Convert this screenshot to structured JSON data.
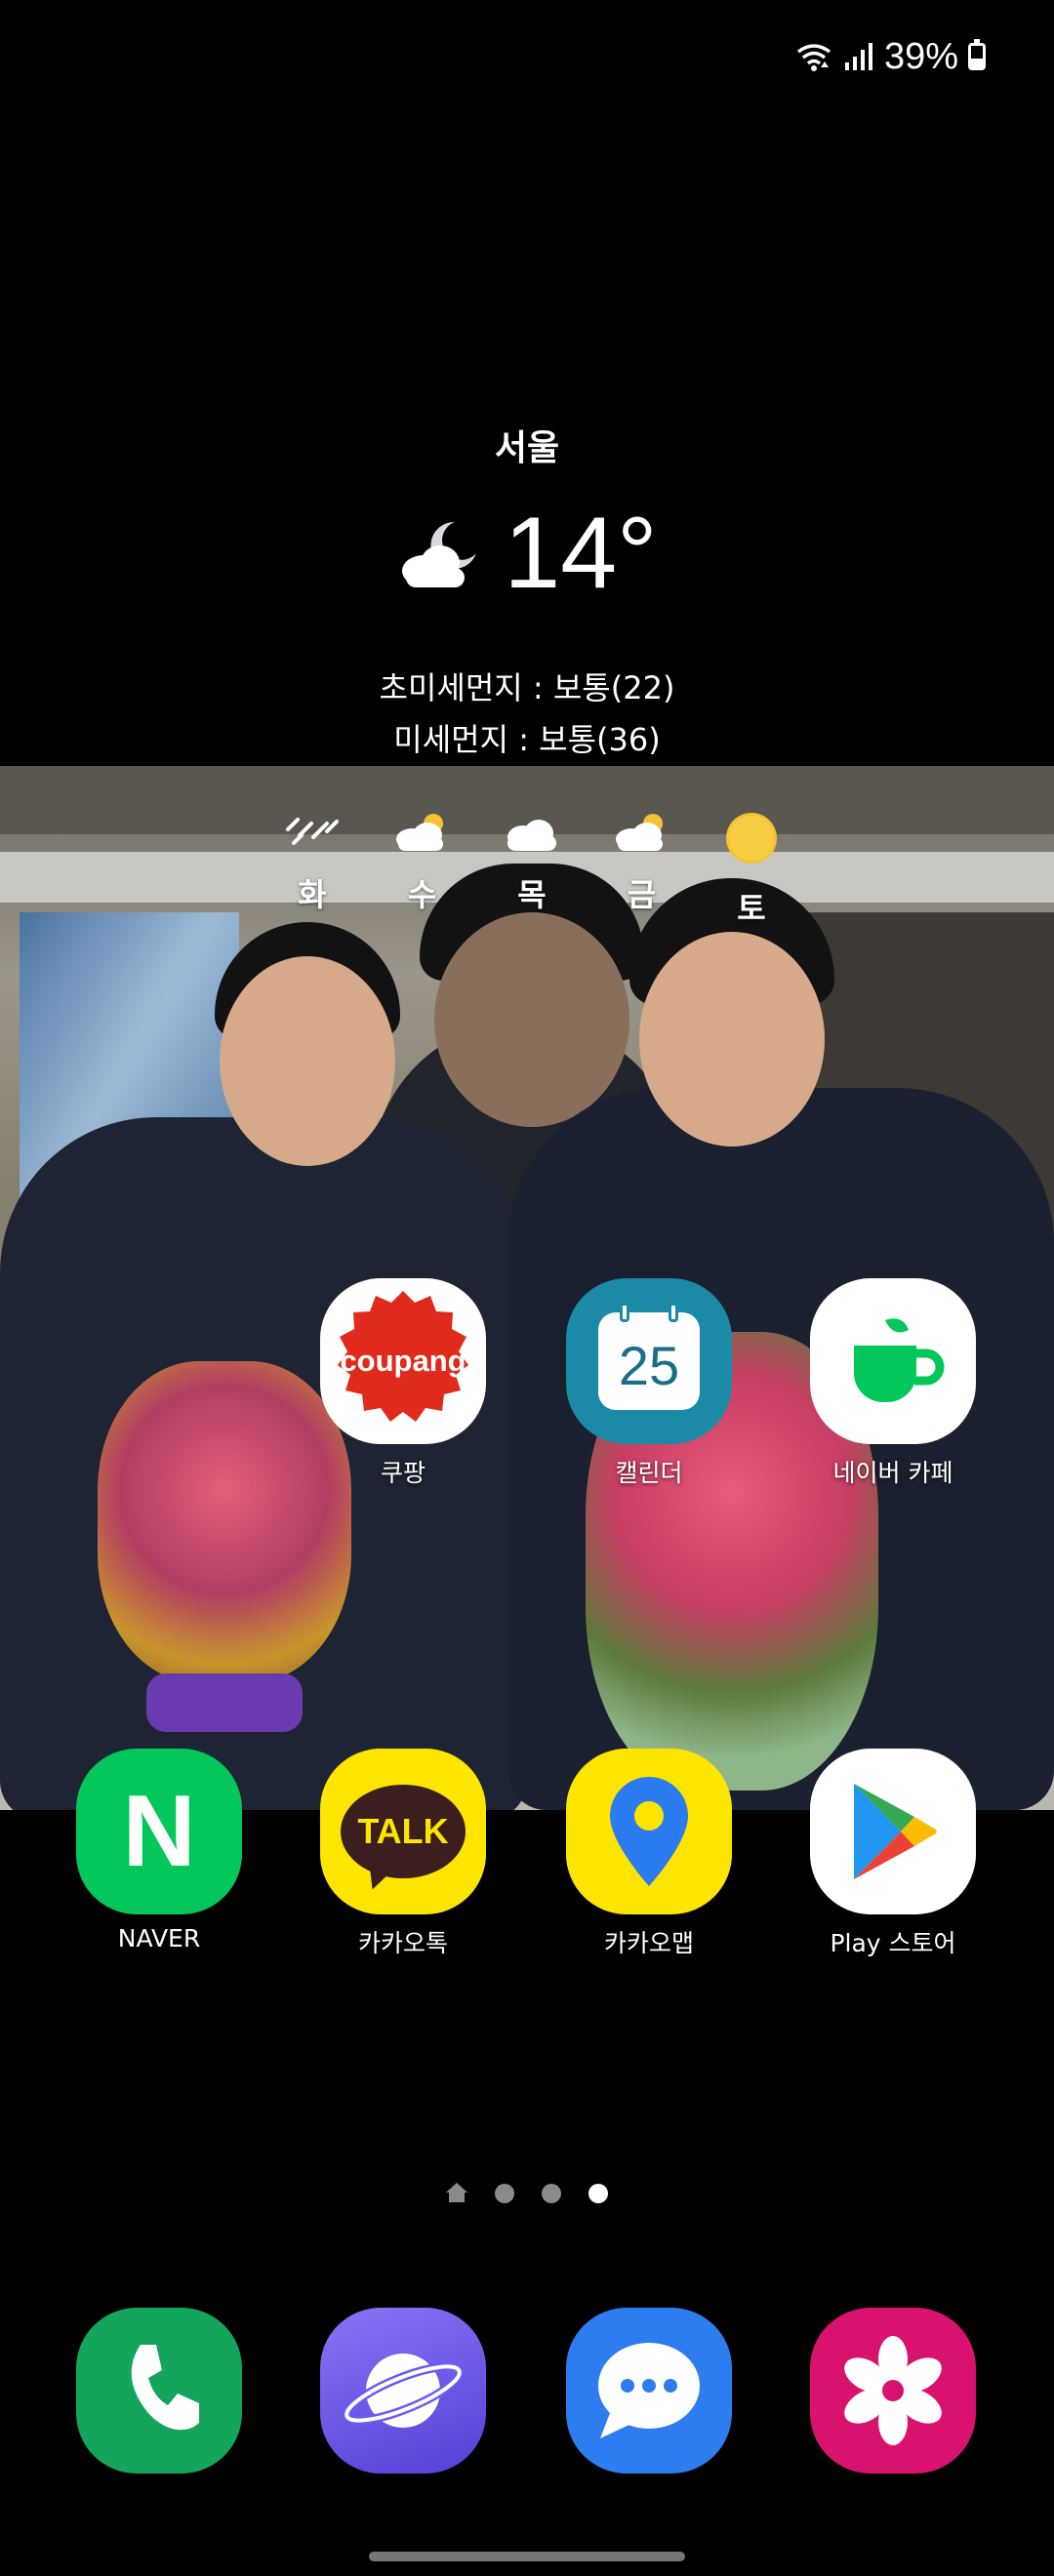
{
  "status_bar": {
    "battery_percent": "39%",
    "battery_level": 0.39
  },
  "weather": {
    "city": "서울",
    "temperature": "14°",
    "condition_icon": "moon-cloud-icon",
    "fine_dust_ultra": "초미세먼지 : 보통(22)",
    "fine_dust": "미세먼지 : 보통(36)",
    "forecast": [
      {
        "day": "화",
        "icon": "rain-icon"
      },
      {
        "day": "수",
        "icon": "sun-cloud-icon"
      },
      {
        "day": "목",
        "icon": "cloud-icon"
      },
      {
        "day": "금",
        "icon": "sun-cloud-icon"
      },
      {
        "day": "토",
        "icon": "sun-icon"
      }
    ]
  },
  "apps_row1": [
    {
      "label": "쿠팡",
      "icon_text": "coupang"
    },
    {
      "label": "캘린더",
      "icon_text": "25"
    },
    {
      "label": "네이버 카페",
      "icon_text": ""
    }
  ],
  "apps_row2": [
    {
      "label": "NAVER",
      "icon_text": "N"
    },
    {
      "label": "카카오톡",
      "icon_text": "TALK"
    },
    {
      "label": "카카오맵",
      "icon_text": ""
    },
    {
      "label": "Play 스토어",
      "icon_text": ""
    }
  ],
  "page_indicator": {
    "pages": 4,
    "current": 4
  },
  "dock": [
    {
      "name": "phone",
      "icon": "phone-icon"
    },
    {
      "name": "internet",
      "icon": "planet-icon"
    },
    {
      "name": "messages",
      "icon": "chat-icon"
    },
    {
      "name": "gallery",
      "icon": "flower-icon"
    }
  ],
  "colors": {
    "coupang_red": "#e02b1c",
    "calendar_teal": "#1b8aa6",
    "naver_green": "#03c75a",
    "kakao_yellow": "#fee500",
    "phone_green": "#13a55c",
    "internet_purple": "#6a5cf0",
    "messages_blue": "#2d7cf0",
    "gallery_pink": "#d8126e"
  }
}
